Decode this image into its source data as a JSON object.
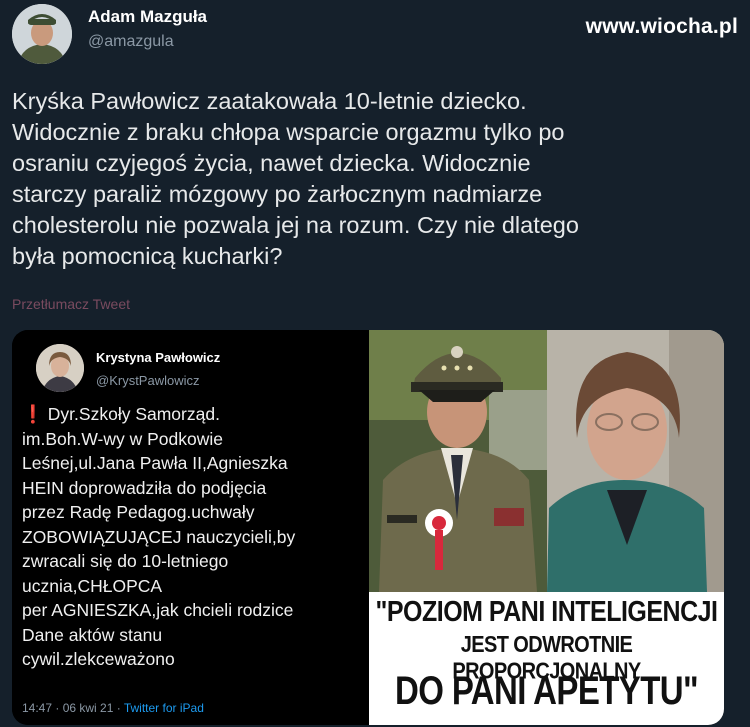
{
  "tweet": {
    "author_name": "Adam Mazguła",
    "author_handle": "@amazgula",
    "text": "Kryśka Pawłowicz zaatakowała 10-letnie dziecko.\nWidocznie z braku chłopa wsparcie orgazmu tylko po\nosraniu czyjegoś życia, nawet dziecka. Widocznie\nstarczy paraliż mózgowy po żarłocznym nadmiarze\ncholesterolu nie pozwala jej na rozum. Czy nie dlatego\nbyła pomocnicą kucharki?",
    "translate_label": "Przetłumacz Tweet"
  },
  "watermark": "www.wiocha.pl",
  "embedded_tweet": {
    "author_name": "Krystyna Pawłowicz",
    "author_handle": "@KrystPawlowicz",
    "lines": [
      "Dyr.Szkoły Samorząd.",
      "im.Boh.W-wy w Podkowie",
      "Leśnej,ul.Jana Pawła II,Agnieszka",
      "HEIN doprowadziła do podjęcia",
      "przez Radę Pedagog.uchwały",
      "ZOBOWIĄZUJĄCEJ nauczycieli,by",
      "zwracali się do 10-letniego",
      "ucznia,CHŁOPCA",
      "per AGNIESZKA,jak chcieli rodzice",
      "Dane aktów stanu",
      "cywil.zlekceważono"
    ],
    "timestamp": "14:47 · 06 kwi 21 ·",
    "source": "Twitter for iPad"
  },
  "caption": {
    "line1": "\"POZIOM PANI INTELIGENCJI",
    "line2": "JEST ODWROTNIE PROPORCJONALNY",
    "line3": "DO PANI APETYTU\""
  },
  "colors": {
    "background": "#15202b",
    "link_blue": "#1d9bf0",
    "alert_red": "#e0245e"
  }
}
